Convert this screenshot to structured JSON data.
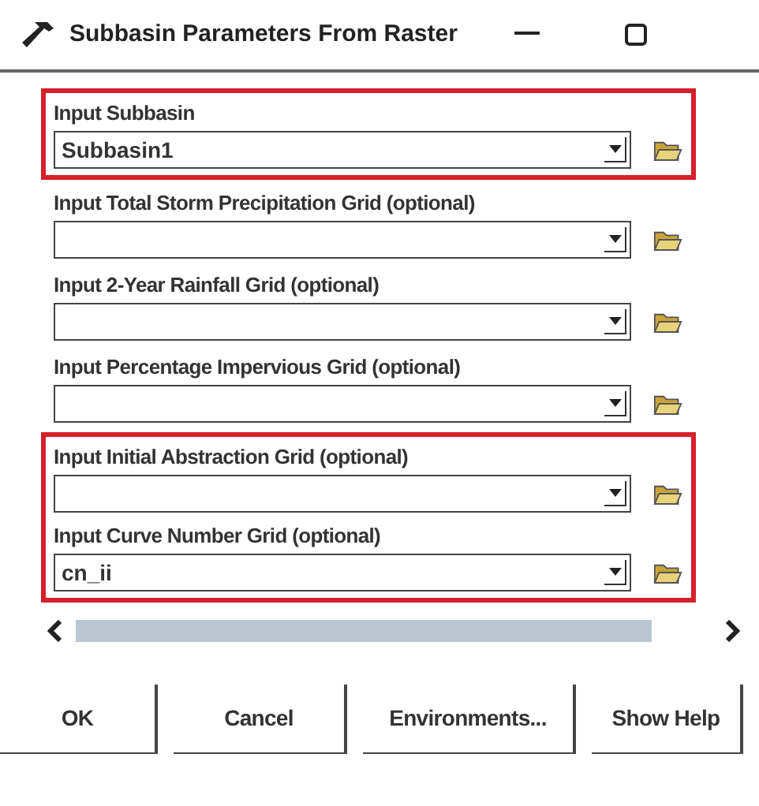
{
  "window": {
    "title": "Subbasin Parameters From Raster"
  },
  "groups": [
    {
      "highlighted": true,
      "fields": [
        {
          "label": "Input Subbasin",
          "value": "Subbasin1"
        }
      ]
    },
    {
      "highlighted": false,
      "fields": [
        {
          "label": "Input Total Storm Precipitation Grid (optional)"
        },
        {
          "label": "Input 2-Year Rainfall Grid (optional)"
        },
        {
          "label": "Input Percentage Impervious Grid (optional)"
        }
      ]
    },
    {
      "highlighted": true,
      "fields": [
        {
          "label": "Input Initial Abstraction Grid (optional)"
        },
        {
          "label": "Input Curve Number Grid (optional)",
          "value": "cn_ii"
        }
      ]
    }
  ],
  "buttons": [
    "OK",
    "Cancel",
    "Environments...",
    "Show Help"
  ]
}
